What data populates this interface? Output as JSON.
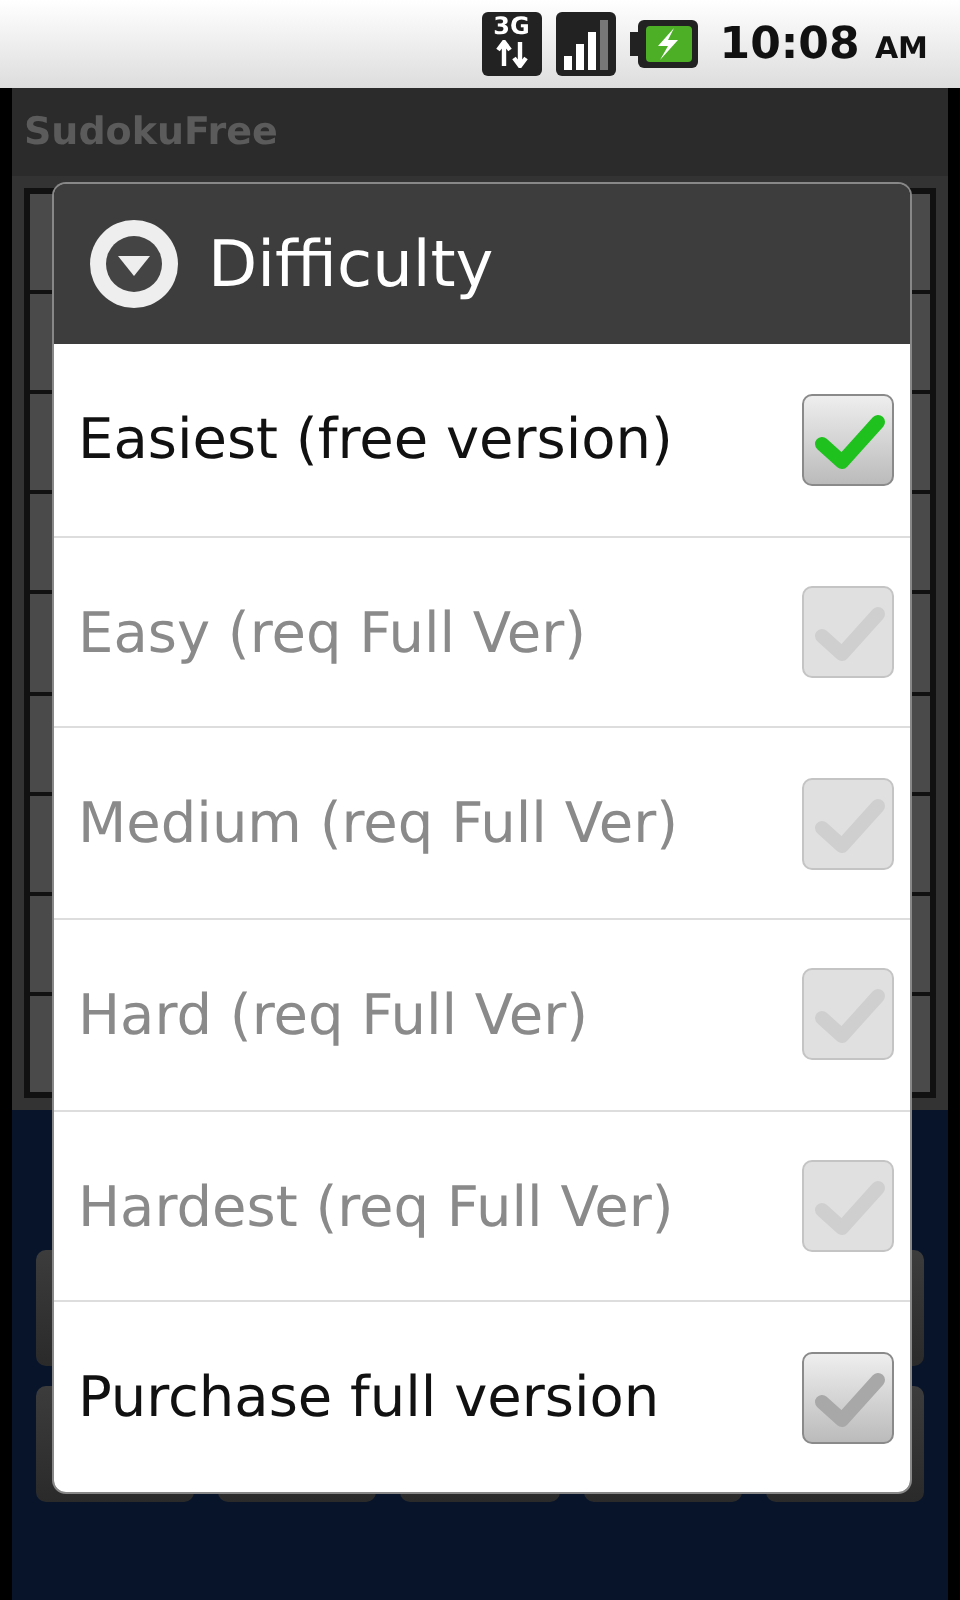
{
  "status_bar": {
    "network_type": "3G",
    "time": "10:08",
    "meridiem": "AM"
  },
  "app": {
    "title": "SudokuFree"
  },
  "dialog": {
    "title": "Difficulty",
    "items": [
      {
        "label": "Easiest (free version)",
        "checked": true,
        "disabled": false
      },
      {
        "label": "Easy (req Full Ver)",
        "checked": false,
        "disabled": true
      },
      {
        "label": "Medium (req Full Ver)",
        "checked": false,
        "disabled": true
      },
      {
        "label": "Hard (req Full Ver)",
        "checked": false,
        "disabled": true
      },
      {
        "label": "Hardest (req Full Ver)",
        "checked": false,
        "disabled": true
      },
      {
        "label": "Purchase full version",
        "checked": false,
        "disabled": false
      }
    ]
  }
}
